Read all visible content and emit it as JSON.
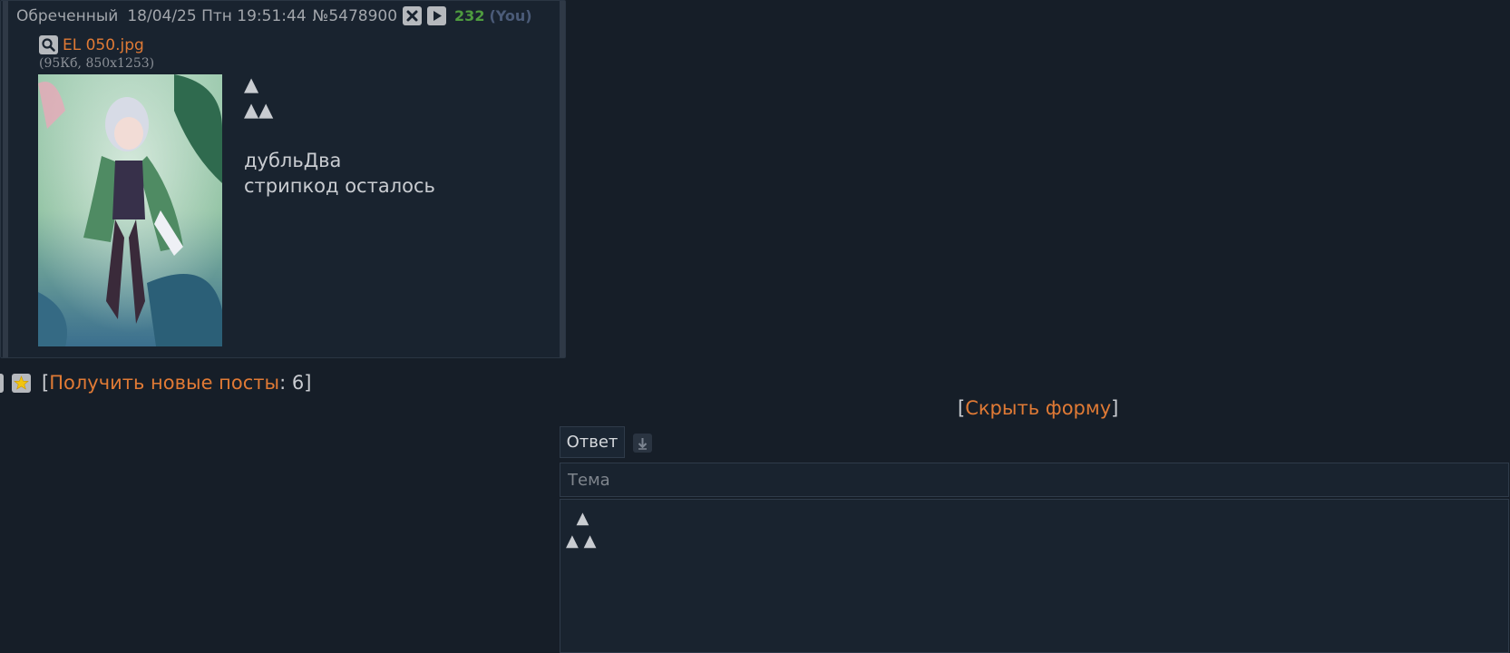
{
  "post": {
    "name": "Обреченный",
    "date": "18/04/25 Птн 19:51:44",
    "number": "№5478900",
    "reply_count": "232",
    "you_label": "(You)",
    "file_name": "EL 050.jpg",
    "file_meta": "(95Кб, 850x1253)",
    "body": {
      "line1": "▲",
      "line2": "▲▲",
      "line3": "дубльДва",
      "line4": "стрипкод осталось"
    }
  },
  "thread_actions": {
    "open_bracket": "[",
    "get_new_posts_label": "Получить новые посты",
    "colon_count": ": 6",
    "close_bracket": "]"
  },
  "form": {
    "hide_open": "[",
    "hide_label": "Скрыть форму",
    "hide_close": "]",
    "reply_tab_label": "Ответ",
    "subject_placeholder": "Тема",
    "message_text": "  ▲\n▲ ▲"
  },
  "icons": {
    "hide_post": "close-x-icon",
    "play": "play-icon",
    "zoom": "zoom-icon",
    "favorite": "star-icon",
    "move_down": "arrow-down-icon"
  },
  "colors": {
    "background": "#161e28",
    "post_background": "#19232f",
    "link": "#e07a35",
    "reply_count": "#4e9b3f",
    "you": "#4b5b78"
  }
}
